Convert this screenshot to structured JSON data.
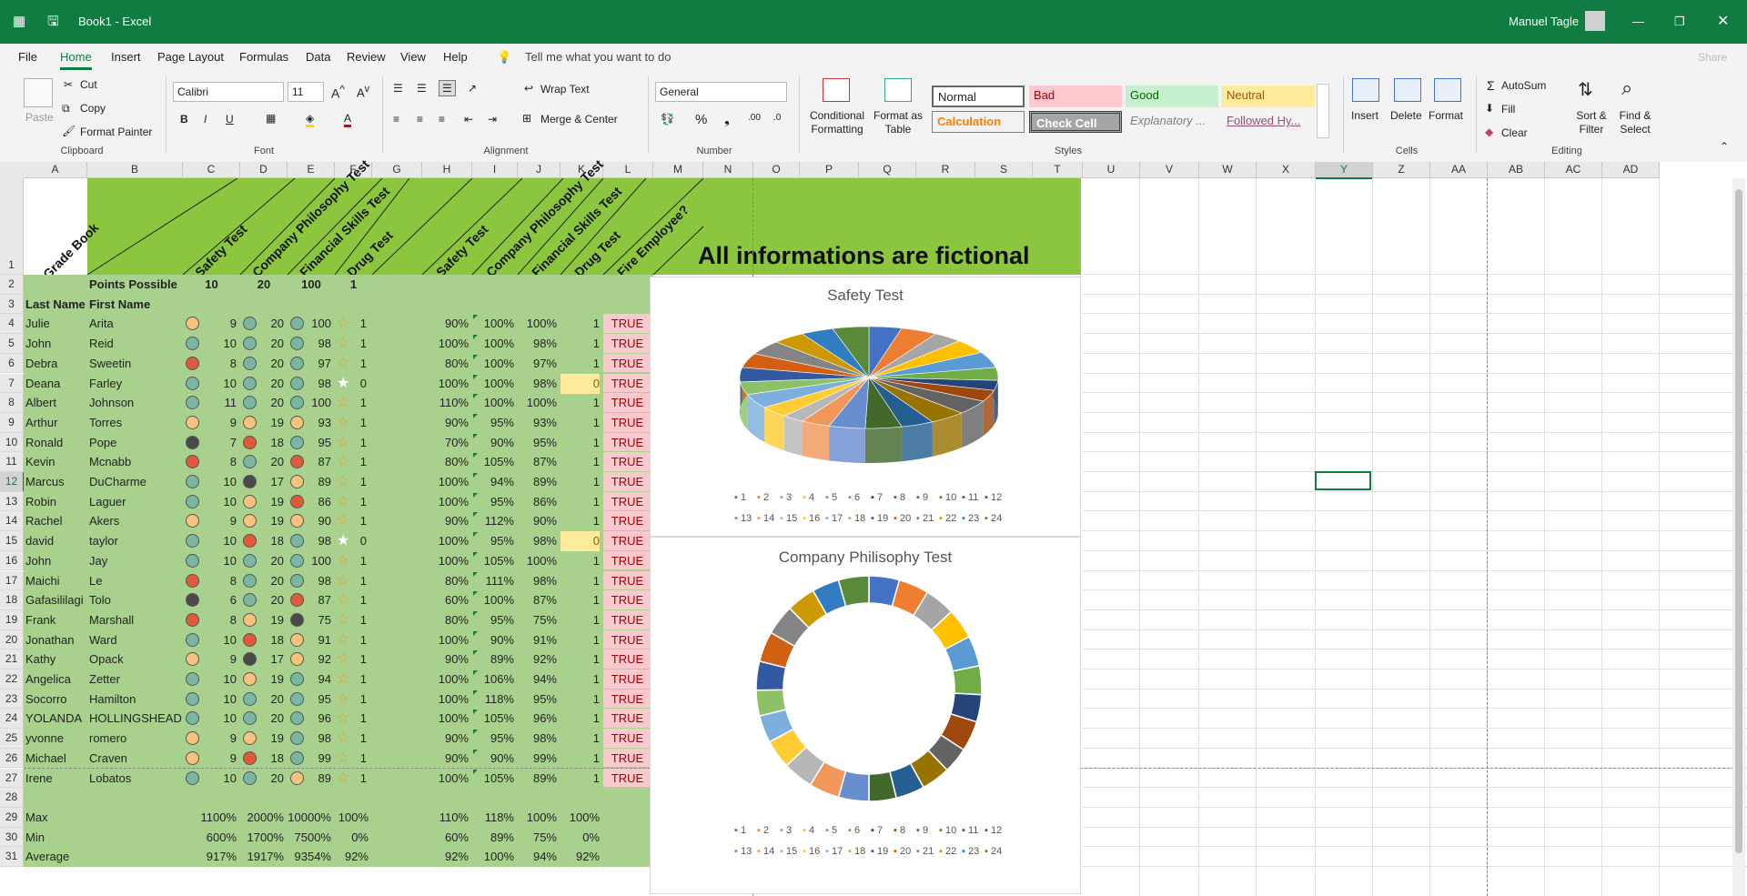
{
  "window": {
    "title": "Book1  -  Excel",
    "user": "Manuel Tagle"
  },
  "menu": {
    "items": [
      "File",
      "Home",
      "Insert",
      "Page Layout",
      "Formulas",
      "Data",
      "Review",
      "View",
      "Help"
    ],
    "tell_me": "Tell me what you want to do",
    "share": "Share"
  },
  "ribbon": {
    "clipboard": {
      "paste": "Paste",
      "cut": "Cut",
      "copy": "Copy",
      "format_painter": "Format Painter",
      "label": "Clipboard"
    },
    "font": {
      "name": "Calibri",
      "size": "11",
      "label": "Font"
    },
    "alignment": {
      "wrap": "Wrap Text",
      "merge": "Merge & Center",
      "label": "Alignment"
    },
    "number": {
      "format": "General",
      "label": "Number"
    },
    "styles": {
      "conditional": "Conditional Formatting",
      "format_table": "Format as Table",
      "normal": "Normal",
      "bad": "Bad",
      "good": "Good",
      "neutral": "Neutral",
      "calculation": "Calculation",
      "check_cell": "Check Cell",
      "explanatory": "Explanatory ...",
      "followed": "Followed Hy...",
      "label": "Styles"
    },
    "cells": {
      "insert": "Insert",
      "delete": "Delete",
      "format": "Format",
      "label": "Cells"
    },
    "editing": {
      "autosum": "AutoSum",
      "fill": "Fill",
      "clear": "Clear",
      "sort": "Sort & Filter",
      "find": "Find & Select",
      "label": "Editing"
    }
  },
  "columns": [
    "A",
    "B",
    "C",
    "D",
    "E",
    "F",
    "G",
    "H",
    "I",
    "J",
    "K",
    "L",
    "M",
    "N",
    "O",
    "P",
    "Q",
    "R",
    "S",
    "T",
    "U",
    "V",
    "W",
    "X",
    "Y",
    "Z",
    "AA",
    "AB",
    "AC",
    "AD"
  ],
  "header": {
    "grade_book": "Grade Book",
    "tests": [
      "Safety Test",
      "Company Philosophy Test",
      "Financial Skills Test",
      "Drug Test"
    ],
    "tests_pct": [
      "Safety Test",
      "Company Philosophy Test",
      "Financial Skills Test",
      "Drug Test",
      "Fire Employee?"
    ],
    "banner": "All informations are fictional"
  },
  "row2": {
    "label": "Points Possible",
    "vals": [
      "10",
      "20",
      "100",
      "1"
    ]
  },
  "row3": {
    "last": "Last Name",
    "first": "First Name"
  },
  "students": [
    {
      "n": 4,
      "last": "Julie",
      "first": "Arita",
      "s": "9",
      "c": "20",
      "f": "100",
      "d": "1",
      "sp": "90%",
      "cp": "100%",
      "fp": "100%",
      "dp": "1",
      "fire": "TRUE",
      "c1": "#f7c27c",
      "c2": "#7ab6a4",
      "c3": "#7ab6a4",
      "dz": 0
    },
    {
      "n": 5,
      "last": "John",
      "first": "Reid",
      "s": "10",
      "c": "20",
      "f": "98",
      "d": "1",
      "sp": "100%",
      "cp": "100%",
      "fp": "98%",
      "dp": "1",
      "fire": "TRUE",
      "c1": "#7ab6a4",
      "c2": "#7ab6a4",
      "c3": "#7ab6a4",
      "dz": 0
    },
    {
      "n": 6,
      "last": "Debra",
      "first": "Sweetin",
      "s": "8",
      "c": "20",
      "f": "97",
      "d": "1",
      "sp": "80%",
      "cp": "100%",
      "fp": "97%",
      "dp": "1",
      "fire": "TRUE",
      "c1": "#e05a3a",
      "c2": "#7ab6a4",
      "c3": "#7ab6a4",
      "dz": 0
    },
    {
      "n": 7,
      "last": "Deana",
      "first": "Farley",
      "s": "10",
      "c": "20",
      "f": "98",
      "d": "0",
      "sp": "100%",
      "cp": "100%",
      "fp": "98%",
      "dp": "0",
      "fire": "TRUE",
      "c1": "#7ab6a4",
      "c2": "#7ab6a4",
      "c3": "#7ab6a4",
      "dz": 1
    },
    {
      "n": 8,
      "last": "Albert",
      "first": "Johnson",
      "s": "11",
      "c": "20",
      "f": "100",
      "d": "1",
      "sp": "110%",
      "cp": "100%",
      "fp": "100%",
      "dp": "1",
      "fire": "TRUE",
      "c1": "#7ab6a4",
      "c2": "#7ab6a4",
      "c3": "#7ab6a4",
      "dz": 0
    },
    {
      "n": 9,
      "last": "Arthur",
      "first": "Torres",
      "s": "9",
      "c": "19",
      "f": "93",
      "d": "1",
      "sp": "90%",
      "cp": "95%",
      "fp": "93%",
      "dp": "1",
      "fire": "TRUE",
      "c1": "#f7c27c",
      "c2": "#f7c27c",
      "c3": "#f7c27c",
      "dz": 0
    },
    {
      "n": 10,
      "last": "Ronald",
      "first": "Pope",
      "s": "7",
      "c": "18",
      "f": "95",
      "d": "1",
      "sp": "70%",
      "cp": "90%",
      "fp": "95%",
      "dp": "1",
      "fire": "TRUE",
      "c1": "#4a4a4a",
      "c2": "#e05a3a",
      "c3": "#7ab6a4",
      "dz": 0
    },
    {
      "n": 11,
      "last": "Kevin",
      "first": "Mcnabb",
      "s": "8",
      "c": "20",
      "f": "87",
      "d": "1",
      "sp": "80%",
      "cp": "105%",
      "fp": "87%",
      "dp": "1",
      "fire": "TRUE",
      "c1": "#e05a3a",
      "c2": "#7ab6a4",
      "c3": "#e05a3a",
      "dz": 0
    },
    {
      "n": 12,
      "last": "Marcus",
      "first": "DuCharme",
      "s": "10",
      "c": "17",
      "f": "89",
      "d": "1",
      "sp": "100%",
      "cp": "94%",
      "fp": "89%",
      "dp": "1",
      "fire": "TRUE",
      "c1": "#7ab6a4",
      "c2": "#4a4a4a",
      "c3": "#f7c27c",
      "dz": 0
    },
    {
      "n": 13,
      "last": "Robin",
      "first": "Laguer",
      "s": "10",
      "c": "19",
      "f": "86",
      "d": "1",
      "sp": "100%",
      "cp": "95%",
      "fp": "86%",
      "dp": "1",
      "fire": "TRUE",
      "c1": "#7ab6a4",
      "c2": "#f7c27c",
      "c3": "#e05a3a",
      "dz": 0
    },
    {
      "n": 14,
      "last": "Rachel",
      "first": "Akers",
      "s": "9",
      "c": "19",
      "f": "90",
      "d": "1",
      "sp": "90%",
      "cp": "112%",
      "fp": "90%",
      "dp": "1",
      "fire": "TRUE",
      "c1": "#f7c27c",
      "c2": "#f7c27c",
      "c3": "#f7c27c",
      "dz": 0
    },
    {
      "n": 15,
      "last": "david",
      "first": "taylor",
      "s": "10",
      "c": "18",
      "f": "98",
      "d": "0",
      "sp": "100%",
      "cp": "95%",
      "fp": "98%",
      "dp": "0",
      "fire": "TRUE",
      "c1": "#7ab6a4",
      "c2": "#e05a3a",
      "c3": "#7ab6a4",
      "dz": 1
    },
    {
      "n": 16,
      "last": "John",
      "first": "Jay",
      "s": "10",
      "c": "20",
      "f": "100",
      "d": "1",
      "sp": "100%",
      "cp": "105%",
      "fp": "100%",
      "dp": "1",
      "fire": "TRUE",
      "c1": "#7ab6a4",
      "c2": "#7ab6a4",
      "c3": "#7ab6a4",
      "dz": 0
    },
    {
      "n": 17,
      "last": "Maichi",
      "first": "Le",
      "s": "8",
      "c": "20",
      "f": "98",
      "d": "1",
      "sp": "80%",
      "cp": "111%",
      "fp": "98%",
      "dp": "1",
      "fire": "TRUE",
      "c1": "#e05a3a",
      "c2": "#7ab6a4",
      "c3": "#7ab6a4",
      "dz": 0
    },
    {
      "n": 18,
      "last": "Gafasililagi",
      "first": "Tolo",
      "s": "6",
      "c": "20",
      "f": "87",
      "d": "1",
      "sp": "60%",
      "cp": "100%",
      "fp": "87%",
      "dp": "1",
      "fire": "TRUE",
      "c1": "#4a4a4a",
      "c2": "#7ab6a4",
      "c3": "#e05a3a",
      "dz": 0
    },
    {
      "n": 19,
      "last": "Frank",
      "first": "Marshall",
      "s": "8",
      "c": "19",
      "f": "75",
      "d": "1",
      "sp": "80%",
      "cp": "95%",
      "fp": "75%",
      "dp": "1",
      "fire": "TRUE",
      "c1": "#e05a3a",
      "c2": "#f7c27c",
      "c3": "#4a4a4a",
      "dz": 0
    },
    {
      "n": 20,
      "last": "Jonathan",
      "first": "Ward",
      "s": "10",
      "c": "18",
      "f": "91",
      "d": "1",
      "sp": "100%",
      "cp": "90%",
      "fp": "91%",
      "dp": "1",
      "fire": "TRUE",
      "c1": "#7ab6a4",
      "c2": "#e05a3a",
      "c3": "#f7c27c",
      "dz": 0
    },
    {
      "n": 21,
      "last": "Kathy",
      "first": "Opack",
      "s": "9",
      "c": "17",
      "f": "92",
      "d": "1",
      "sp": "90%",
      "cp": "89%",
      "fp": "92%",
      "dp": "1",
      "fire": "TRUE",
      "c1": "#f7c27c",
      "c2": "#4a4a4a",
      "c3": "#f7c27c",
      "dz": 0
    },
    {
      "n": 22,
      "last": "Angelica",
      "first": "Zetter",
      "s": "10",
      "c": "19",
      "f": "94",
      "d": "1",
      "sp": "100%",
      "cp": "106%",
      "fp": "94%",
      "dp": "1",
      "fire": "TRUE",
      "c1": "#7ab6a4",
      "c2": "#f7c27c",
      "c3": "#7ab6a4",
      "dz": 0
    },
    {
      "n": 23,
      "last": "Socorro",
      "first": "Hamilton",
      "s": "10",
      "c": "20",
      "f": "95",
      "d": "1",
      "sp": "100%",
      "cp": "118%",
      "fp": "95%",
      "dp": "1",
      "fire": "TRUE",
      "c1": "#7ab6a4",
      "c2": "#7ab6a4",
      "c3": "#7ab6a4",
      "dz": 0
    },
    {
      "n": 24,
      "last": "YOLANDA",
      "first": "HOLLINGSHEAD",
      "s": "10",
      "c": "20",
      "f": "96",
      "d": "1",
      "sp": "100%",
      "cp": "105%",
      "fp": "96%",
      "dp": "1",
      "fire": "TRUE",
      "c1": "#7ab6a4",
      "c2": "#7ab6a4",
      "c3": "#7ab6a4",
      "dz": 0
    },
    {
      "n": 25,
      "last": "yvonne",
      "first": "romero",
      "s": "9",
      "c": "19",
      "f": "98",
      "d": "1",
      "sp": "90%",
      "cp": "95%",
      "fp": "98%",
      "dp": "1",
      "fire": "TRUE",
      "c1": "#f7c27c",
      "c2": "#f7c27c",
      "c3": "#7ab6a4",
      "dz": 0
    },
    {
      "n": 26,
      "last": "Michael",
      "first": "Craven",
      "s": "9",
      "c": "18",
      "f": "99",
      "d": "1",
      "sp": "90%",
      "cp": "90%",
      "fp": "99%",
      "dp": "1",
      "fire": "TRUE",
      "c1": "#f7c27c",
      "c2": "#e05a3a",
      "c3": "#7ab6a4",
      "dz": 0
    },
    {
      "n": 27,
      "last": "Irene",
      "first": "Lobatos",
      "s": "10",
      "c": "20",
      "f": "89",
      "d": "1",
      "sp": "100%",
      "cp": "105%",
      "fp": "89%",
      "dp": "1",
      "fire": "TRUE",
      "c1": "#7ab6a4",
      "c2": "#7ab6a4",
      "c3": "#f7c27c",
      "dz": 0
    }
  ],
  "stats": [
    {
      "n": 29,
      "label": "Max",
      "s": "1100%",
      "c": "2000%",
      "f": "10000%",
      "d": "100%",
      "sp": "110%",
      "cp": "118%",
      "fp": "100%",
      "dp": "100%"
    },
    {
      "n": 30,
      "label": "Min",
      "s": "600%",
      "c": "1700%",
      "f": "7500%",
      "d": "0%",
      "sp": "60%",
      "cp": "89%",
      "fp": "75%",
      "dp": "0%"
    },
    {
      "n": 31,
      "label": "Average",
      "s": "917%",
      "c": "1917%",
      "f": "9354%",
      "d": "92%",
      "sp": "92%",
      "cp": "100%",
      "fp": "94%",
      "dp": "92%"
    }
  ],
  "chart_data": [
    {
      "type": "pie",
      "title": "Safety Test",
      "categories": [
        "1",
        "2",
        "3",
        "4",
        "5",
        "6",
        "7",
        "8",
        "9",
        "10",
        "11",
        "12",
        "13",
        "14",
        "15",
        "16",
        "17",
        "18",
        "19",
        "20",
        "21",
        "22",
        "23",
        "24"
      ],
      "values": [
        9,
        10,
        8,
        10,
        11,
        9,
        7,
        8,
        10,
        10,
        9,
        10,
        10,
        8,
        6,
        8,
        10,
        9,
        10,
        10,
        10,
        9,
        9,
        10
      ]
    },
    {
      "type": "pie",
      "title": "Company Philisophy Test",
      "categories": [
        "1",
        "2",
        "3",
        "4",
        "5",
        "6",
        "7",
        "8",
        "9",
        "10",
        "11",
        "12",
        "13",
        "14",
        "15",
        "16",
        "17",
        "18",
        "19",
        "20",
        "21",
        "22",
        "23",
        "24"
      ],
      "values": [
        20,
        20,
        20,
        20,
        20,
        19,
        18,
        20,
        17,
        19,
        19,
        18,
        20,
        20,
        20,
        19,
        18,
        17,
        19,
        20,
        20,
        19,
        18,
        20
      ]
    }
  ],
  "palette": [
    "#4472c4",
    "#ed7d31",
    "#a5a5a5",
    "#ffc000",
    "#5b9bd5",
    "#70ad47",
    "#264478",
    "#9e480e",
    "#636363",
    "#997300",
    "#255e91",
    "#43682b",
    "#698ed0",
    "#f1975a",
    "#b7b7b7",
    "#ffcd33",
    "#7cafdd",
    "#8cc168",
    "#335aa1",
    "#d26012",
    "#848484",
    "#cc9a00",
    "#327dc2",
    "#5a8a39"
  ],
  "selected_cell": "Y12",
  "colors": {
    "green_header": "#8cc63f",
    "green_body": "#a9d18e",
    "fire_bg": "#f9c9ce",
    "fire_text": "#9c0006",
    "excel_green": "#107c41"
  }
}
